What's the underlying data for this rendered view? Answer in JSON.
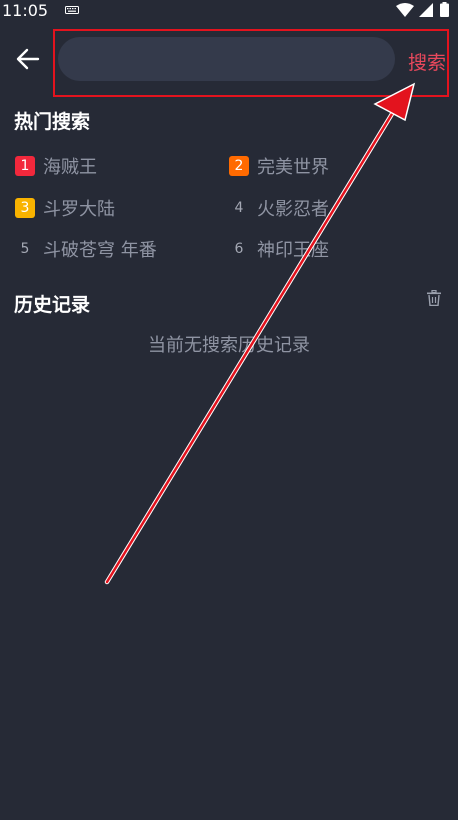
{
  "status_bar": {
    "time": "11:05"
  },
  "search": {
    "placeholder": "",
    "value": "",
    "button_label": "搜索"
  },
  "hot": {
    "title": "热门搜索",
    "items": [
      {
        "rank": "1",
        "label": "海贼王",
        "color": "#f2283c"
      },
      {
        "rank": "2",
        "label": "完美世界",
        "color": "#ff6a00"
      },
      {
        "rank": "3",
        "label": "斗罗大陆",
        "color": "#f9b300"
      },
      {
        "rank": "4",
        "label": "火影忍者",
        "color": ""
      },
      {
        "rank": "5",
        "label": "斗破苍穹 年番",
        "color": ""
      },
      {
        "rank": "6",
        "label": "神印王座",
        "color": ""
      }
    ]
  },
  "history": {
    "title": "历史记录",
    "empty_text": "当前无搜索历史记录"
  },
  "icons": {
    "back": "arrow-left-icon",
    "trash": "trash-icon",
    "wifi": "wifi-icon",
    "signal": "signal-icon",
    "battery": "battery-icon",
    "keyboard": "keyboard-icon"
  },
  "colors": {
    "background": "#262a36",
    "search_field": "#343a4b",
    "accent": "#e8485c",
    "annotation": "#e3131e"
  }
}
